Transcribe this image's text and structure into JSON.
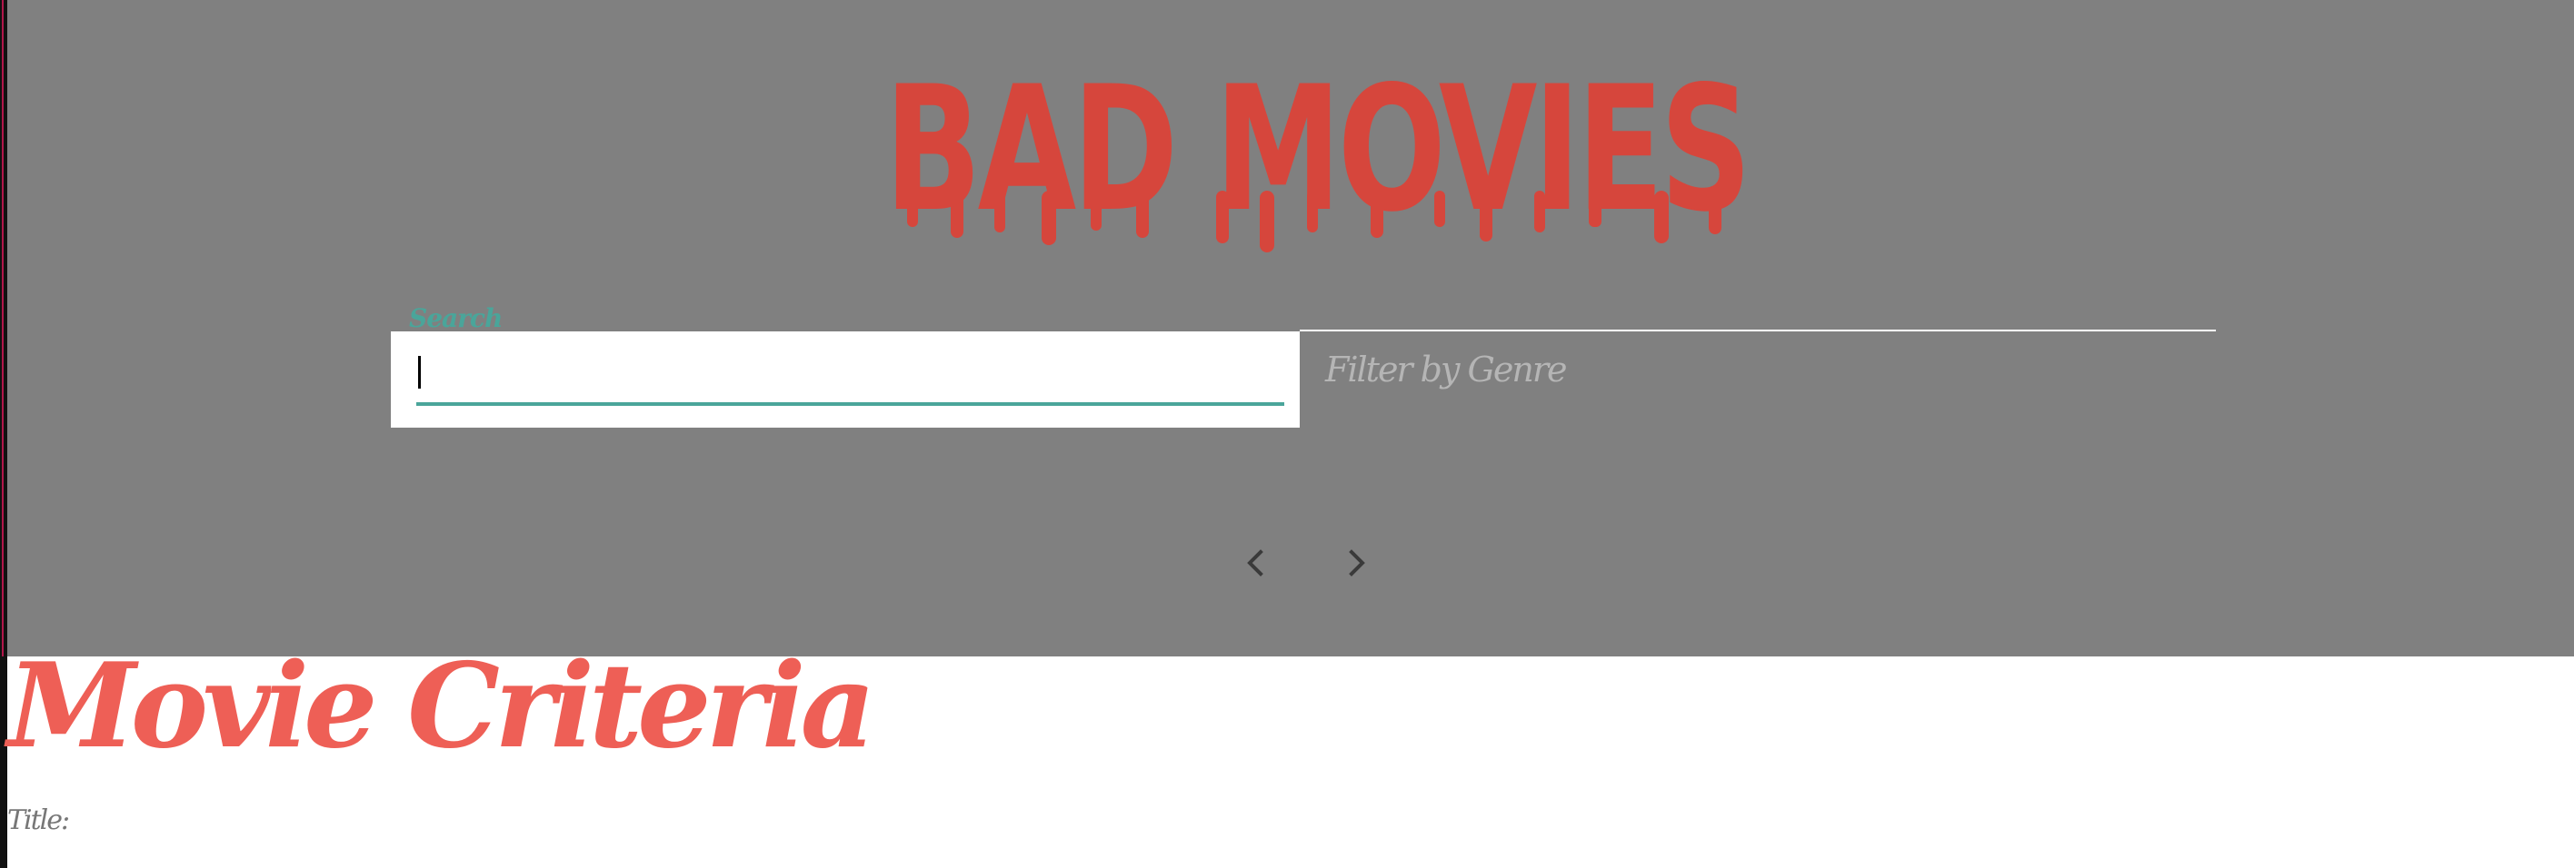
{
  "header": {
    "logo_text": "BAD MOVIES",
    "logo_color": "#d6463c",
    "background": "#808080"
  },
  "search": {
    "label": "Search",
    "value": "",
    "accent": "#4aa59a"
  },
  "genre_filter": {
    "placeholder": "Filter by Genre"
  },
  "pagination": {
    "prev_icon": "chevron-left-icon",
    "next_icon": "chevron-right-icon"
  },
  "criteria": {
    "title": "Movie Criteria",
    "title_color": "#ee5f56",
    "title_field_label": "Title:"
  }
}
